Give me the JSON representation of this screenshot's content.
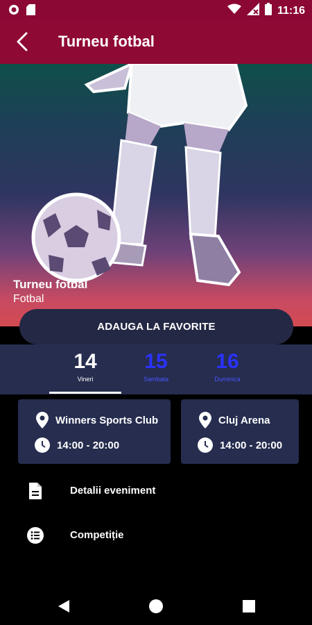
{
  "status_bar": {
    "time": "11:16",
    "icons": [
      "notification-circle-icon",
      "sd-card-icon",
      "wifi-icon",
      "signal-icon",
      "battery-icon"
    ]
  },
  "app_bar": {
    "title": "Turneu fotbal",
    "back_icon": "arrow-back-icon",
    "background": "#8f0935"
  },
  "hero": {
    "event_name": "Turneu fotbal",
    "category": "Fotbal"
  },
  "favorite_button": {
    "label": "ADAUGA LA FAVORITE"
  },
  "days": [
    {
      "number": "14",
      "label": "Vineri",
      "selected": true
    },
    {
      "number": "15",
      "label": "Sambata",
      "selected": false
    },
    {
      "number": "16",
      "label": "Duminica",
      "selected": false
    }
  ],
  "locations": [
    {
      "venue": "Winners Sports Club",
      "hours": "14:00 - 20:00"
    },
    {
      "venue": "Cluj Arena",
      "hours": "14:00 - 20:00"
    }
  ],
  "menu": [
    {
      "label": "Detalii eveniment",
      "icon": "document-icon"
    },
    {
      "label": "Competiție",
      "icon": "list-icon"
    }
  ],
  "colors": {
    "accent": "#8f0935",
    "card": "#262d4f",
    "day_unselected": "#2a32ff"
  }
}
